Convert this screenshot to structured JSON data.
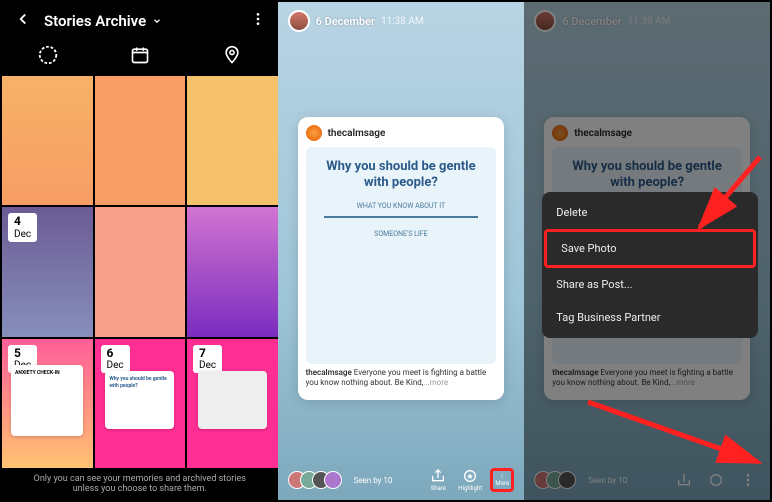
{
  "panel1": {
    "title": "Stories Archive",
    "dates": [
      {
        "day": "4",
        "month": "Dec"
      },
      {
        "day": "5",
        "month": "Dec"
      },
      {
        "day": "6",
        "month": "Dec"
      },
      {
        "day": "7",
        "month": "Dec"
      }
    ],
    "footer": "Only you can see your memories and archived stories unless you choose to share them.",
    "tile8_title": "Why you should be gentle with people?",
    "tile7_title": "ANXIETY CHECK-IN"
  },
  "panel2": {
    "date": "6 December",
    "time": "11:38 AM",
    "card_user": "thecalmsage",
    "card_title": "Why you should be gentle with people?",
    "scribble1": "WHAT YOU KNOW ABOUT IT",
    "scribble2": "SOMEONE'S LIFE",
    "caption_user": "thecalmsage",
    "caption_text": " Everyone you meet is fighting a battle you know nothing about. Be Kind,",
    "caption_more": "...more",
    "seen_by": "Seen by 10",
    "action_share": "Share",
    "action_highlight": "Highlight",
    "action_more": "More"
  },
  "panel3": {
    "menu": {
      "delete": "Delete",
      "save": "Save Photo",
      "share_post": "Share as Post...",
      "tag_partner": "Tag Business Partner"
    }
  }
}
